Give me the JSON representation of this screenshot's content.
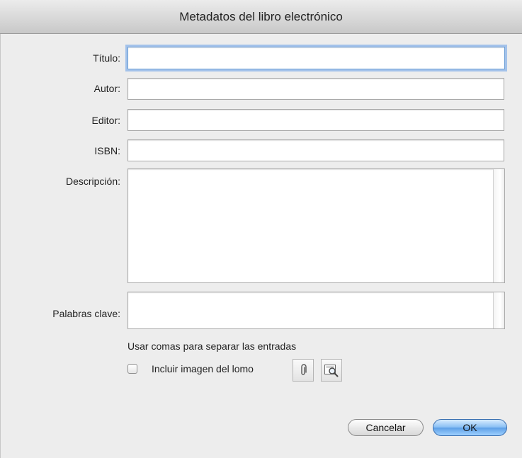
{
  "dialog": {
    "title": "Metadatos del libro electrónico"
  },
  "fields": {
    "title_label": "Título:",
    "title_value": "",
    "author_label": "Autor:",
    "author_value": "",
    "editor_label": "Editor:",
    "editor_value": "",
    "isbn_label": "ISBN:",
    "isbn_value": "",
    "description_label": "Descripción:",
    "description_value": "",
    "keywords_label": "Palabras clave:",
    "keywords_value": ""
  },
  "keywords_hint": "Usar comas para separar las entradas",
  "spine": {
    "checkbox_label": "Incluir imagen del lomo",
    "checked": false,
    "attach_icon": "paperclip-icon",
    "preview_icon": "image-preview-magnifier-icon"
  },
  "buttons": {
    "cancel_label": "Cancelar",
    "ok_label": "OK"
  },
  "colors": {
    "focus_ring": "#a3c2ea",
    "default_button": "#5c9ee6"
  }
}
